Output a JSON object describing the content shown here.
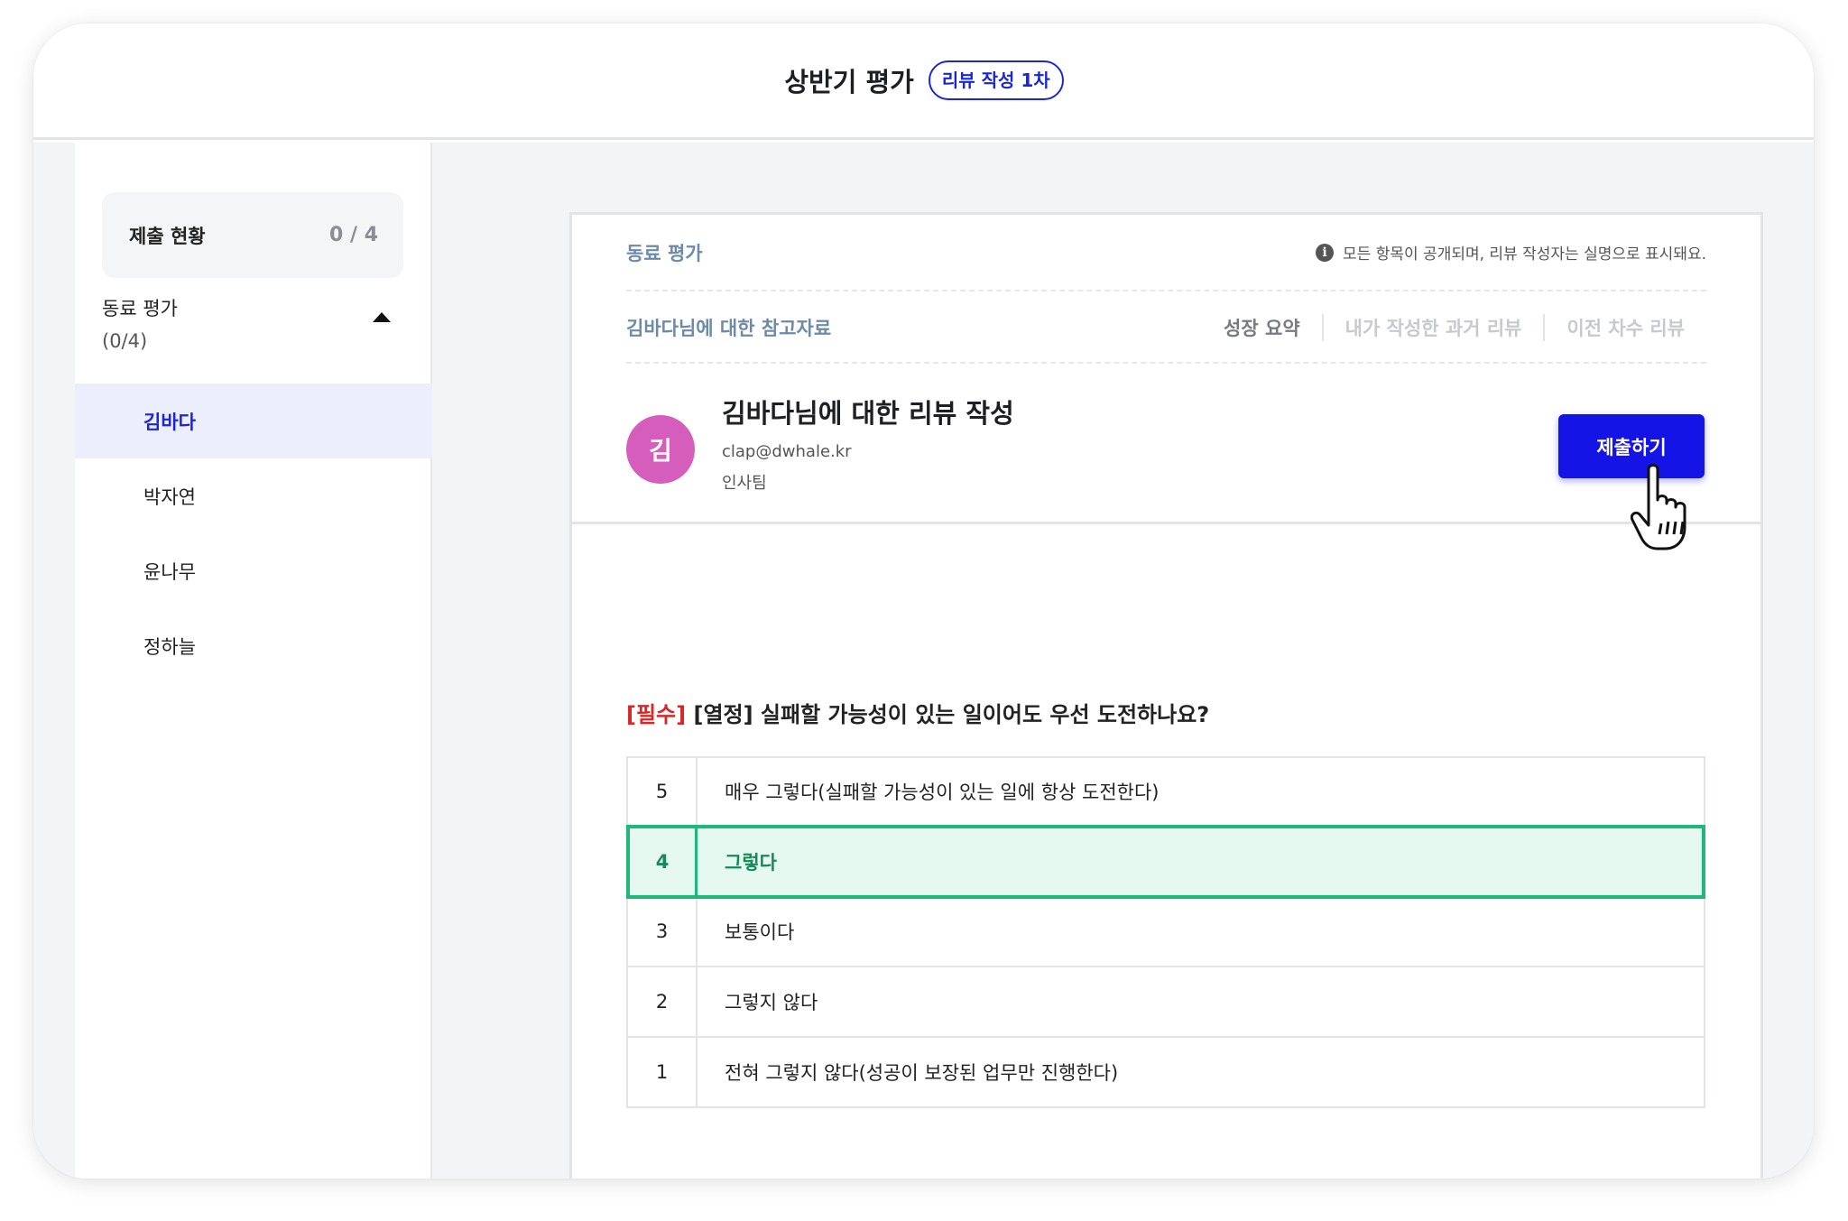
{
  "header": {
    "title": "상반기 평가",
    "round_badge": "리뷰 작성 1차"
  },
  "sidebar": {
    "status_label": "제출 현황",
    "status_count": "0 / 4",
    "group_title": "동료 평가",
    "group_count": "(0/4)",
    "items": [
      {
        "label": "김바다",
        "active": true
      },
      {
        "label": "박자연"
      },
      {
        "label": "윤나무"
      },
      {
        "label": "정하늘"
      }
    ]
  },
  "card": {
    "section_label": "동료 평가",
    "notice": "모든 항목이 공개되며, 리뷰 작성자는 실명으로 표시돼요.",
    "reference_label": "김바다님에 대한 참고자료",
    "reference_tabs": [
      "성장 요약",
      "내가 작성한 과거 리뷰",
      "이전 차수 리뷰"
    ],
    "avatar_initial": "김",
    "avatar_color": "#d55dbc",
    "review_title": "김바다님에 대한 리뷰 작성",
    "email": "clap@dwhale.kr",
    "department": "인사팀",
    "submit_label": "제출하기",
    "accent_color": "#1414e6"
  },
  "question": {
    "required_tag": "[필수]",
    "text": "[열정] 실패할 가능성이 있는 일이어도 우선 도전하나요?",
    "options": [
      {
        "score": "5",
        "label": "매우 그렇다(실패할 가능성이 있는 일에 항상 도전한다)"
      },
      {
        "score": "4",
        "label": "그렇다",
        "selected": true
      },
      {
        "score": "3",
        "label": "보통이다"
      },
      {
        "score": "2",
        "label": "그렇지 않다"
      },
      {
        "score": "1",
        "label": "전혀 그렇지 않다(성공이 보장된 업무만 진행한다)"
      }
    ],
    "selected_color": "#1fb87a"
  }
}
